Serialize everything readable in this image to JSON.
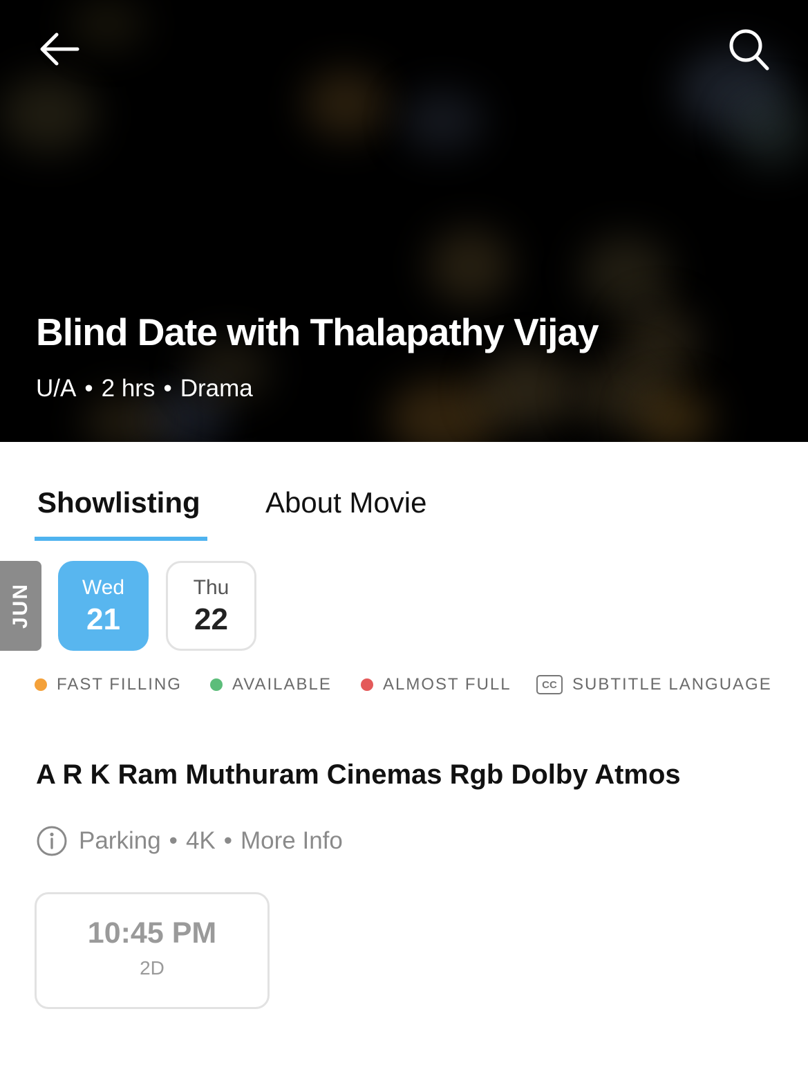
{
  "colors": {
    "accent": "#4fb3ef",
    "selected_date_bg": "#58b6ef",
    "fast_filling": "#f4a13a",
    "available": "#5cbd7a",
    "almost_full": "#e45a5a"
  },
  "header": {
    "back_icon": "arrow-left-icon",
    "search_icon": "search-icon",
    "title": "Blind Date with Thalapathy Vijay",
    "meta": {
      "rating": "U/A",
      "duration": "2 hrs",
      "genre": "Drama",
      "separator": "•"
    }
  },
  "tabs": [
    {
      "label": "Showlisting",
      "active": true
    },
    {
      "label": "About Movie",
      "active": false
    }
  ],
  "dates": {
    "month": "JUN",
    "days": [
      {
        "dow": "Wed",
        "day": "21",
        "selected": true
      },
      {
        "dow": "Thu",
        "day": "22",
        "selected": false
      }
    ]
  },
  "legend": [
    {
      "label": "FAST FILLING",
      "type": "dot"
    },
    {
      "label": "AVAILABLE",
      "type": "dot"
    },
    {
      "label": "ALMOST FULL",
      "type": "dot"
    },
    {
      "label": "SUBTITLE LANGUAGE",
      "type": "cc",
      "icon_text": "CC"
    }
  ],
  "cinema": {
    "name": "A R K Ram Muthuram Cinemas Rgb Dolby Atmos",
    "info": {
      "icon": "info-icon",
      "parking": "Parking",
      "format": "4K",
      "more": "More Info",
      "separator": "•"
    },
    "showtimes": [
      {
        "time": "10:45 PM",
        "format": "2D"
      }
    ]
  }
}
